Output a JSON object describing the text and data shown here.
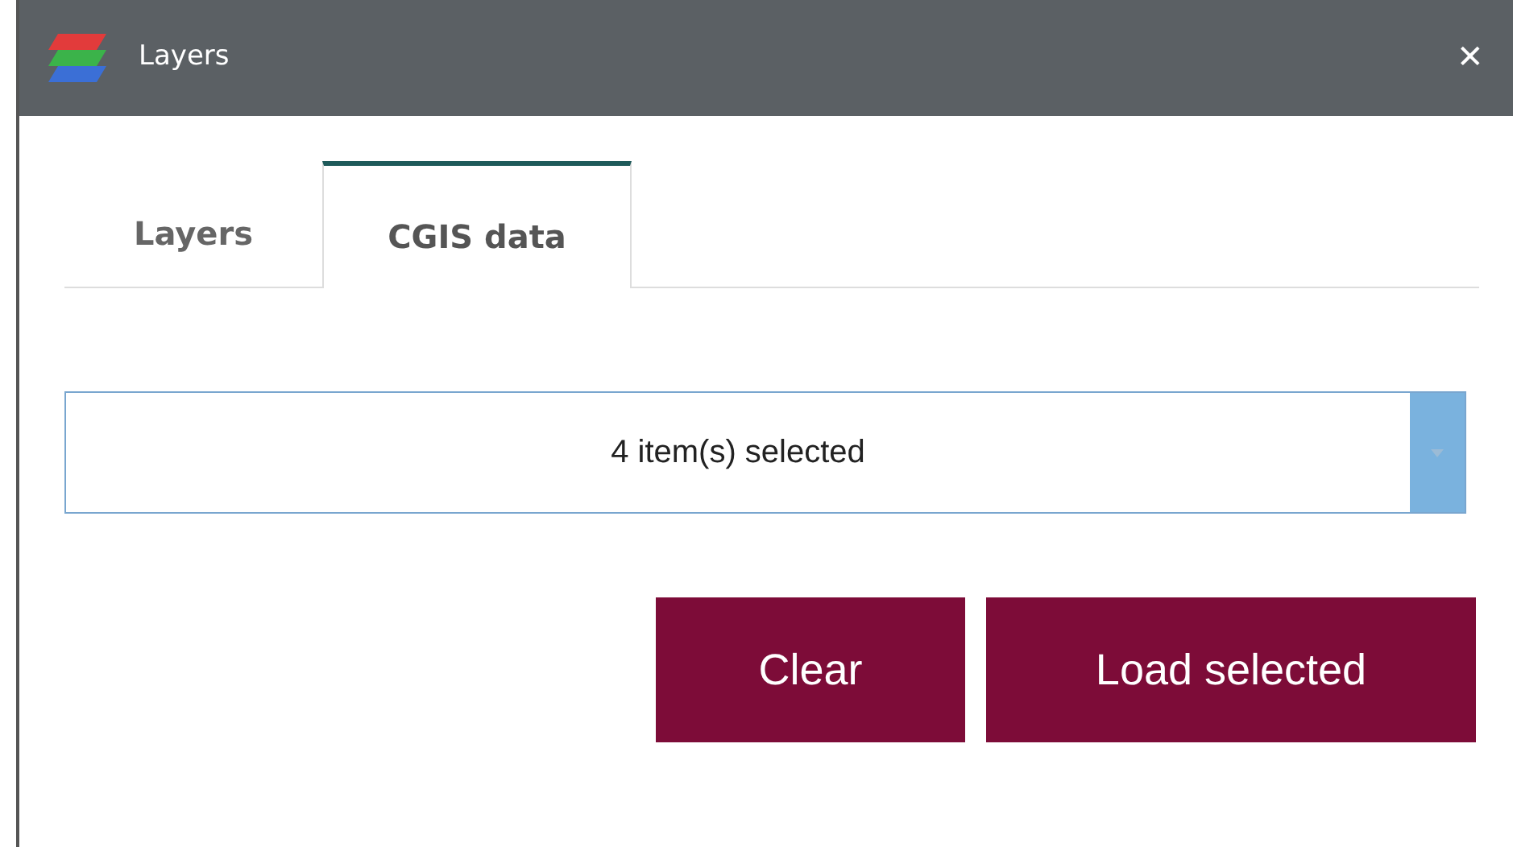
{
  "window": {
    "title": "Layers",
    "close": "✕"
  },
  "tabs": [
    {
      "label": "Layers",
      "selected": false
    },
    {
      "label": "CGIS data",
      "selected": true
    }
  ],
  "dropdown": {
    "value": "4 item(s) selected"
  },
  "buttons": [
    "Clear",
    "Load selected"
  ]
}
